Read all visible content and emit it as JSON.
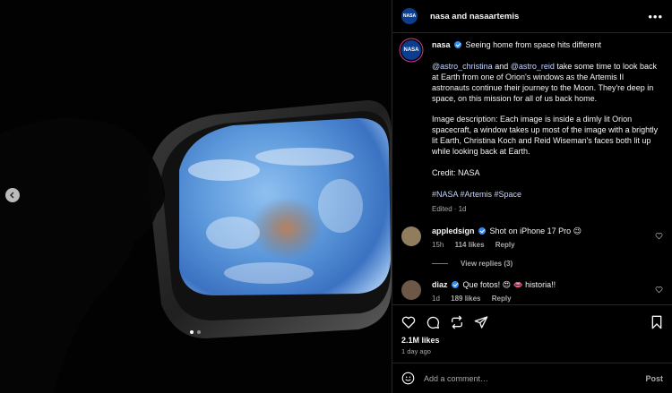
{
  "colors": {
    "accent": "#c5d4ff",
    "verified": "#2f8cf0",
    "background": "#000000",
    "muted": "#a8a8a8"
  },
  "header": {
    "avatar_text": "NASA",
    "title": "nasa and nasaartemis",
    "more_icon": "more-horizontal-icon"
  },
  "caption": {
    "username": "nasa",
    "avatar_text": "NASA",
    "headline": "Seeing home from space hits different",
    "mention1": "@astro_christina",
    "and_text": "and",
    "mention2": "@astro_reid",
    "text1": "take some time to look back at Earth from one of Orion's windows as the Artemis II astronauts continue their journey to the Moon. They're deep in space, on this mission for all of us back home.",
    "text2": "Image description: Each image is inside a dimly lit Orion spacecraft, a window takes up most of the image with a brightly lit Earth, Christina Koch and Reid Wiseman's faces both lit up while looking back at Earth.",
    "credit": "Credit: NASA",
    "hashtags": "#NASA #Artemis #Space",
    "edited": "Edited",
    "time": "1d"
  },
  "comments": [
    {
      "username": "appledsign",
      "text": "Shot on iPhone 17 Pro 😉",
      "time": "15h",
      "likes": "114 likes",
      "reply": "Reply",
      "view_replies": "View replies (3)"
    },
    {
      "username": "diaz",
      "text": "Que fotos! 😍 👄 historia!!",
      "time": "1d",
      "likes": "189 likes",
      "reply": "Reply"
    }
  ],
  "actions": {
    "likes": "2.1M likes",
    "ago": "1 day ago"
  },
  "add_comment": {
    "placeholder": "Add a comment…",
    "post": "Post"
  },
  "media": {
    "dots": 2,
    "active_dot": 0
  }
}
